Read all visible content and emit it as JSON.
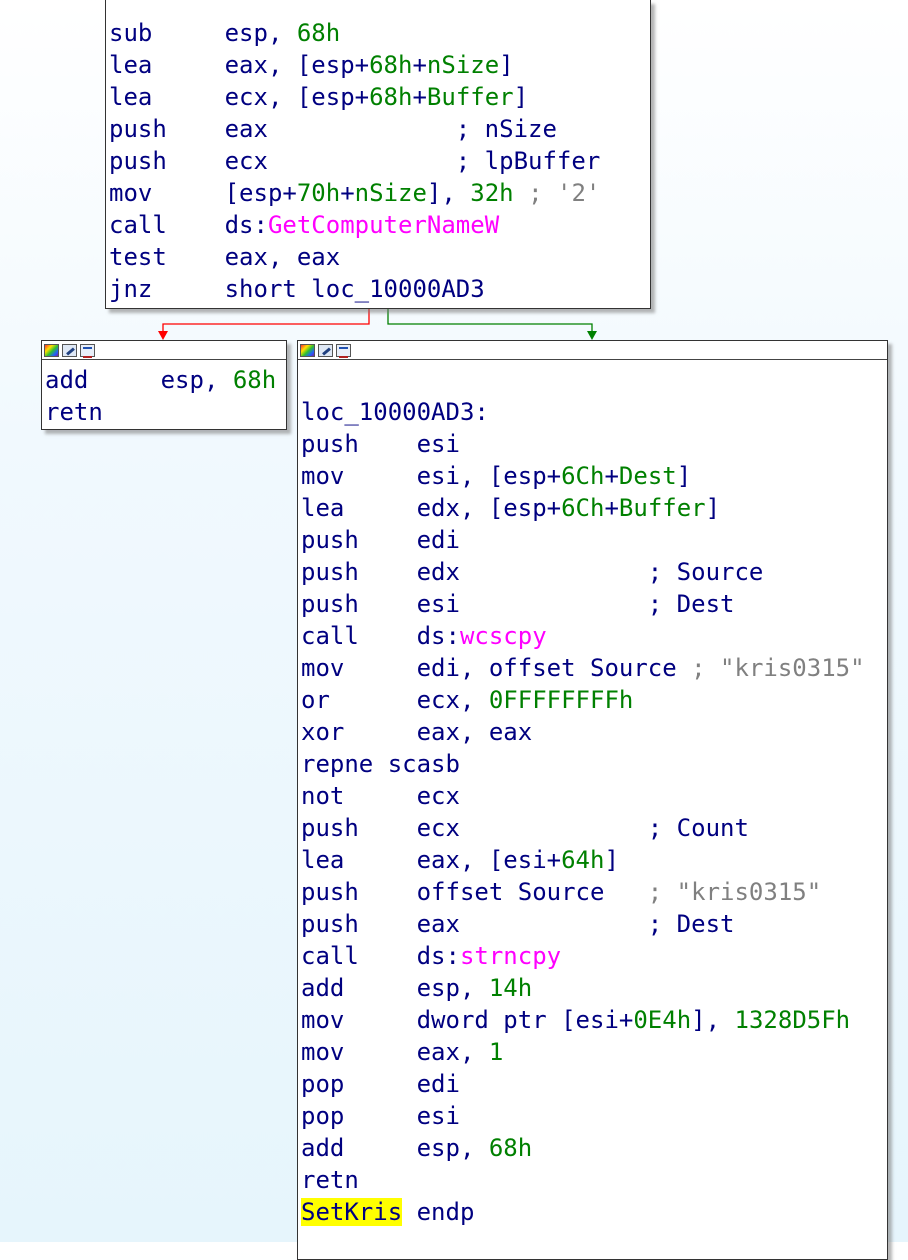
{
  "blocks": {
    "top": {
      "lines": [
        {
          "mnem": "sub",
          "ops": [
            {
              "t": "esp, ",
              "c": "n"
            },
            {
              "t": "68h",
              "c": "g"
            }
          ]
        },
        {
          "mnem": "lea",
          "ops": [
            {
              "t": "eax, [esp+",
              "c": "n"
            },
            {
              "t": "68h",
              "c": "g"
            },
            {
              "t": "+",
              "c": "n"
            },
            {
              "t": "nSize",
              "c": "g"
            },
            {
              "t": "]",
              "c": "n"
            }
          ]
        },
        {
          "mnem": "lea",
          "ops": [
            {
              "t": "ecx, [esp+",
              "c": "n"
            },
            {
              "t": "68h",
              "c": "g"
            },
            {
              "t": "+",
              "c": "n"
            },
            {
              "t": "Buffer",
              "c": "g"
            },
            {
              "t": "]",
              "c": "n"
            }
          ]
        },
        {
          "mnem": "push",
          "ops": [
            {
              "t": "eax             ; nSize",
              "c": "n"
            }
          ]
        },
        {
          "mnem": "push",
          "ops": [
            {
              "t": "ecx             ; lpBuffer",
              "c": "n"
            }
          ]
        },
        {
          "mnem": "mov",
          "ops": [
            {
              "t": "[esp+",
              "c": "n"
            },
            {
              "t": "70h",
              "c": "g"
            },
            {
              "t": "+",
              "c": "n"
            },
            {
              "t": "nSize",
              "c": "g"
            },
            {
              "t": "], ",
              "c": "n"
            },
            {
              "t": "32h",
              "c": "g"
            },
            {
              "t": " ; '2'",
              "c": "c"
            }
          ]
        },
        {
          "mnem": "call",
          "ops": [
            {
              "t": "ds:",
              "c": "n"
            },
            {
              "t": "GetComputerNameW",
              "c": "m"
            }
          ]
        },
        {
          "mnem": "test",
          "ops": [
            {
              "t": "eax, eax",
              "c": "n"
            }
          ]
        },
        {
          "mnem": "jnz",
          "ops": [
            {
              "t": "short loc_10000AD3",
              "c": "n"
            }
          ]
        }
      ]
    },
    "left": {
      "lines": [
        {
          "mnem": "add",
          "ops": [
            {
              "t": "esp, ",
              "c": "n"
            },
            {
              "t": "68h",
              "c": "g"
            }
          ]
        },
        {
          "mnem": "retn",
          "ops": []
        }
      ]
    },
    "right": {
      "label": "loc_10000AD3:",
      "lines": [
        {
          "mnem": "push",
          "ops": [
            {
              "t": "esi",
              "c": "n"
            }
          ]
        },
        {
          "mnem": "mov",
          "ops": [
            {
              "t": "esi, [esp+",
              "c": "n"
            },
            {
              "t": "6Ch",
              "c": "g"
            },
            {
              "t": "+",
              "c": "n"
            },
            {
              "t": "Dest",
              "c": "g"
            },
            {
              "t": "]",
              "c": "n"
            }
          ]
        },
        {
          "mnem": "lea",
          "ops": [
            {
              "t": "edx, [esp+",
              "c": "n"
            },
            {
              "t": "6Ch",
              "c": "g"
            },
            {
              "t": "+",
              "c": "n"
            },
            {
              "t": "Buffer",
              "c": "g"
            },
            {
              "t": "]",
              "c": "n"
            }
          ]
        },
        {
          "mnem": "push",
          "ops": [
            {
              "t": "edi",
              "c": "n"
            }
          ]
        },
        {
          "mnem": "push",
          "ops": [
            {
              "t": "edx             ; Source",
              "c": "n"
            }
          ]
        },
        {
          "mnem": "push",
          "ops": [
            {
              "t": "esi             ; Dest",
              "c": "n"
            }
          ]
        },
        {
          "mnem": "call",
          "ops": [
            {
              "t": "ds:",
              "c": "n"
            },
            {
              "t": "wcscpy",
              "c": "m"
            }
          ]
        },
        {
          "mnem": "mov",
          "ops": [
            {
              "t": "edi, offset Source",
              "c": "n"
            },
            {
              "t": " ; \"kris0315\"",
              "c": "c"
            }
          ]
        },
        {
          "mnem": "or",
          "ops": [
            {
              "t": "ecx, ",
              "c": "n"
            },
            {
              "t": "0FFFFFFFFh",
              "c": "g"
            }
          ]
        },
        {
          "mnem": "xor",
          "ops": [
            {
              "t": "eax, eax",
              "c": "n"
            }
          ]
        },
        {
          "mnem": "repne scasb",
          "ops": []
        },
        {
          "mnem": "not",
          "ops": [
            {
              "t": "ecx",
              "c": "n"
            }
          ]
        },
        {
          "mnem": "push",
          "ops": [
            {
              "t": "ecx             ; Count",
              "c": "n"
            }
          ]
        },
        {
          "mnem": "lea",
          "ops": [
            {
              "t": "eax, [esi+",
              "c": "n"
            },
            {
              "t": "64h",
              "c": "g"
            },
            {
              "t": "]",
              "c": "n"
            }
          ]
        },
        {
          "mnem": "push",
          "ops": [
            {
              "t": "offset Source   ",
              "c": "n"
            },
            {
              "t": "; \"kris0315\"",
              "c": "c"
            }
          ]
        },
        {
          "mnem": "push",
          "ops": [
            {
              "t": "eax             ; Dest",
              "c": "n"
            }
          ]
        },
        {
          "mnem": "call",
          "ops": [
            {
              "t": "ds:",
              "c": "n"
            },
            {
              "t": "strncpy",
              "c": "m"
            }
          ]
        },
        {
          "mnem": "add",
          "ops": [
            {
              "t": "esp, ",
              "c": "n"
            },
            {
              "t": "14h",
              "c": "g"
            }
          ]
        },
        {
          "mnem": "mov",
          "ops": [
            {
              "t": "dword ptr [esi+",
              "c": "n"
            },
            {
              "t": "0E4h",
              "c": "g"
            },
            {
              "t": "], ",
              "c": "n"
            },
            {
              "t": "1328D5Fh",
              "c": "g"
            }
          ]
        },
        {
          "mnem": "mov",
          "ops": [
            {
              "t": "eax, ",
              "c": "n"
            },
            {
              "t": "1",
              "c": "g"
            }
          ]
        },
        {
          "mnem": "pop",
          "ops": [
            {
              "t": "edi",
              "c": "n"
            }
          ]
        },
        {
          "mnem": "pop",
          "ops": [
            {
              "t": "esi",
              "c": "n"
            }
          ]
        },
        {
          "mnem": "add",
          "ops": [
            {
              "t": "esp, ",
              "c": "n"
            },
            {
              "t": "68h",
              "c": "g"
            }
          ]
        },
        {
          "mnem": "retn",
          "ops": []
        }
      ],
      "footer": {
        "proc": "SetKris",
        "keyword": "endp"
      }
    }
  },
  "colors": {
    "edge_false": "#ff0000",
    "edge_true": "#008000",
    "text": "#000080",
    "number": "#008000",
    "import": "#ff00ff",
    "comment": "#808080",
    "highlight": "#ffff00"
  },
  "icons": [
    "color-palette-icon",
    "pencil-icon",
    "graph-icon"
  ]
}
